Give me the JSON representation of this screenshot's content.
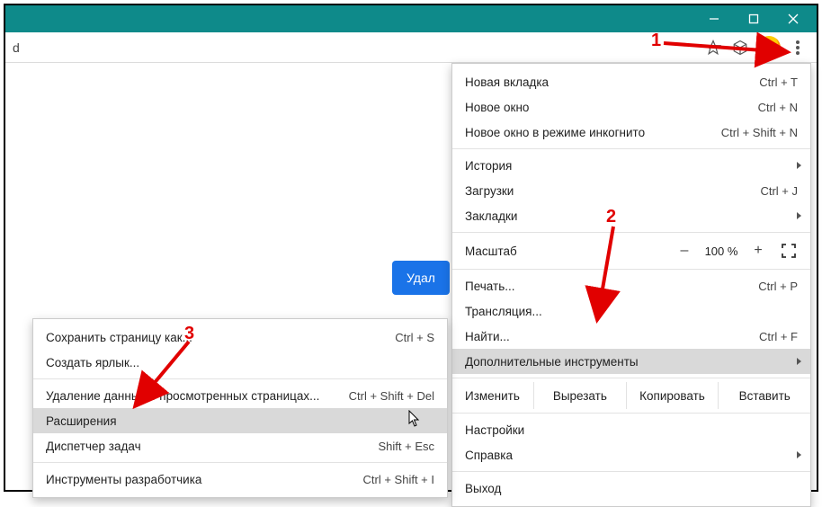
{
  "urlbar": {
    "text": "d"
  },
  "button": {
    "delete": "Удал"
  },
  "mainMenu": {
    "newTab": {
      "label": "Новая вкладка",
      "shortcut": "Ctrl + T"
    },
    "newWindow": {
      "label": "Новое окно",
      "shortcut": "Ctrl + N"
    },
    "incognito": {
      "label": "Новое окно в режиме инкогнито",
      "shortcut": "Ctrl + Shift + N"
    },
    "history": {
      "label": "История"
    },
    "downloads": {
      "label": "Загрузки",
      "shortcut": "Ctrl + J"
    },
    "bookmarks": {
      "label": "Закладки"
    },
    "zoom": {
      "label": "Масштаб",
      "value": "100 %",
      "minus": "–",
      "plus": "+"
    },
    "print": {
      "label": "Печать...",
      "shortcut": "Ctrl + P"
    },
    "cast": {
      "label": "Трансляция..."
    },
    "find": {
      "label": "Найти...",
      "shortcut": "Ctrl + F"
    },
    "moreTools": {
      "label": "Дополнительные инструменты"
    },
    "edit": {
      "label": "Изменить",
      "cut": "Вырезать",
      "copy": "Копировать",
      "paste": "Вставить"
    },
    "settings": {
      "label": "Настройки"
    },
    "help": {
      "label": "Справка"
    },
    "exit": {
      "label": "Выход"
    }
  },
  "subMenu": {
    "savePage": {
      "label": "Сохранить страницу как...",
      "shortcut": "Ctrl + S"
    },
    "createShortcut": {
      "label": "Создать ярлык..."
    },
    "clearData": {
      "label": "Удаление данных о просмотренных страницах...",
      "shortcut": "Ctrl + Shift + Del"
    },
    "extensions": {
      "label": "Расширения"
    },
    "taskManager": {
      "label": "Диспетчер задач",
      "shortcut": "Shift + Esc"
    },
    "devTools": {
      "label": "Инструменты разработчика",
      "shortcut": "Ctrl + Shift + I"
    }
  },
  "callouts": {
    "one": "1",
    "two": "2",
    "three": "3"
  }
}
